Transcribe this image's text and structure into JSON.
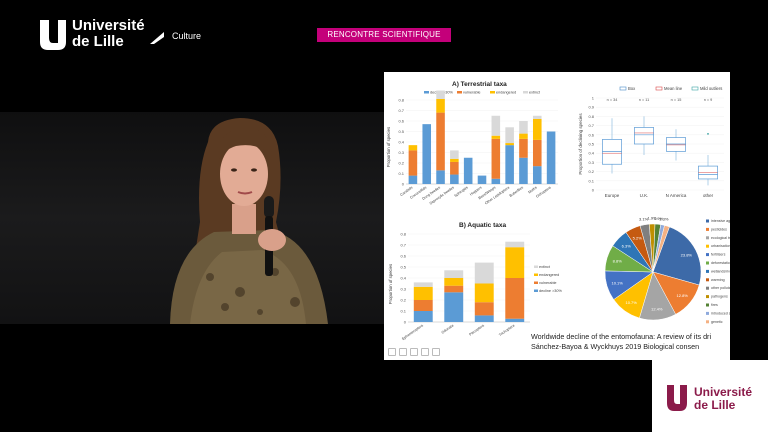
{
  "header": {
    "logo_line1": "Université",
    "logo_line2": "de Lille",
    "culture_label": "Culture",
    "badge": "RENCONTRE SCIENTIFIQUE"
  },
  "slide": {
    "caption_line1": "Worldwide decline of the entomofauna: A review of its dri",
    "caption_line2": "Sánchez-Bayoa & Wyckhuys 2019 Biological consen",
    "terrestrial": {
      "title": "A) Terrestrial taxa",
      "ylabel": "Proportion of species",
      "legend": [
        "decline >30%",
        "vulnerable",
        "endangered",
        "extinct"
      ],
      "yticks": [
        "0.8",
        "0.7",
        "0.6",
        "0.5",
        "0.4",
        "0.3",
        "0.2",
        "0.1",
        "0"
      ],
      "categories": [
        "Carabids",
        "Coccinellids",
        "Dung beetles",
        "Saproxylic beetles",
        "Sphingids",
        "Hoppers",
        "Bees/Wasps",
        "Other Lepidoptera",
        "Butterflies",
        "Moths",
        "Orthoptera"
      ]
    },
    "aquatic": {
      "title": "B) Aquatic taxa",
      "ylabel": "Proportion of species",
      "legend": [
        "extinct",
        "endangered",
        "vulnerable",
        "decline >30%"
      ],
      "yticks": [
        "0.8",
        "0.7",
        "0.6",
        "0.5",
        "0.4",
        "0.3",
        "0.2",
        "0.1",
        "0"
      ],
      "categories": [
        "Ephemeroptera",
        "Odonata",
        "Plecoptera",
        "Trichoptera"
      ]
    },
    "boxplot": {
      "legend": [
        "Box",
        "Mean line",
        "Mild outliers"
      ],
      "ylabel": "Proportion of declining species",
      "yticks": [
        "1",
        "0.9",
        "0.8",
        "0.7",
        "0.6",
        "0.5",
        "0.4",
        "0.3",
        "0.2",
        "0.1",
        "0"
      ],
      "n_labels": [
        "n = 34",
        "n = 11",
        "n = 15",
        "n = 9"
      ],
      "categories": [
        "Europe",
        "U.K.",
        "N America",
        "other"
      ]
    },
    "pie": {
      "slice_labels": [
        "23.8%",
        "12.8%",
        "12.4%",
        "10.7%",
        "10.1%",
        "8.8%",
        "6.3%",
        "5.2%",
        "3.1%",
        "1.9%",
        "1.9%",
        "1.3%"
      ],
      "legend": [
        "intensive agriculture",
        "pesticides",
        "ecological traits",
        "urbanisation",
        "fertilisers",
        "deforestation",
        "wetlands/rivers alteration",
        "warming",
        "other pollutants",
        "pathogens",
        "fires",
        "introduced species",
        "genetic"
      ]
    }
  },
  "footer": {
    "logo_line1": "Université",
    "logo_line2": "de Lille"
  },
  "colors": {
    "brand_pink": "#c4007a",
    "blue": "#5b9bd5",
    "orange": "#ed7d31",
    "gold": "#ffc000",
    "grey": "#d9d9d9",
    "pie_navy": "#3d6aa8"
  },
  "chart_data": [
    {
      "type": "bar",
      "title": "A) Terrestrial taxa",
      "ylabel": "Proportion of species",
      "ylim": [
        0,
        0.8
      ],
      "categories": [
        "Carabids",
        "Coccinellids",
        "Dung beetles",
        "Saproxylic beetles",
        "Sphingids",
        "Hoppers",
        "Bees/Wasps",
        "Other Lepidoptera",
        "Butterflies",
        "Moths",
        "Orthoptera"
      ],
      "series": [
        {
          "name": "decline >30%",
          "values": [
            0.08,
            0.57,
            0.13,
            0.09,
            0.25,
            0.08,
            0.05,
            0.37,
            0.25,
            0.17,
            0.5
          ]
        },
        {
          "name": "vulnerable",
          "values": [
            0.24,
            0.0,
            0.55,
            0.12,
            0.0,
            0.0,
            0.38,
            0.0,
            0.18,
            0.25,
            0.0
          ]
        },
        {
          "name": "endangered",
          "values": [
            0.05,
            0.0,
            0.13,
            0.03,
            0.0,
            0.0,
            0.03,
            0.02,
            0.05,
            0.2,
            0.0
          ]
        },
        {
          "name": "extinct",
          "values": [
            0.0,
            0.0,
            0.08,
            0.08,
            0.0,
            0.0,
            0.19,
            0.15,
            0.12,
            0.03,
            0.0
          ]
        }
      ]
    },
    {
      "type": "bar",
      "title": "B) Aquatic taxa",
      "ylabel": "Proportion of species",
      "ylim": [
        0,
        0.8
      ],
      "categories": [
        "Ephemeroptera",
        "Odonata",
        "Plecoptera",
        "Trichoptera"
      ],
      "series": [
        {
          "name": "decline >30%",
          "values": [
            0.1,
            0.27,
            0.06,
            0.03
          ]
        },
        {
          "name": "vulnerable",
          "values": [
            0.1,
            0.06,
            0.12,
            0.37
          ]
        },
        {
          "name": "endangered",
          "values": [
            0.12,
            0.07,
            0.17,
            0.28
          ]
        },
        {
          "name": "extinct",
          "values": [
            0.04,
            0.07,
            0.19,
            0.05
          ]
        }
      ]
    },
    {
      "type": "boxplot",
      "ylabel": "Proportion of declining species",
      "ylim": [
        0,
        1
      ],
      "categories": [
        "Europe",
        "U.K.",
        "N America",
        "other"
      ],
      "n": [
        34,
        11,
        15,
        9
      ],
      "boxes": [
        {
          "min": 0.18,
          "q1": 0.28,
          "median": 0.42,
          "q3": 0.55,
          "max": 0.78,
          "mean": 0.4
        },
        {
          "min": 0.38,
          "q1": 0.5,
          "median": 0.6,
          "q3": 0.68,
          "max": 0.8,
          "mean": 0.62
        },
        {
          "min": 0.32,
          "q1": 0.42,
          "median": 0.5,
          "q3": 0.57,
          "max": 0.66,
          "mean": 0.49
        },
        {
          "min": 0.05,
          "q1": 0.12,
          "median": 0.17,
          "q3": 0.26,
          "max": 0.38,
          "mean": 0.19,
          "outliers": [
            0.61
          ]
        }
      ]
    },
    {
      "type": "pie",
      "labels": [
        "intensive agriculture",
        "pesticides",
        "ecological traits",
        "urbanisation",
        "fertilisers",
        "deforestation",
        "wetlands/rivers alteration",
        "warming",
        "other pollutants",
        "pathogens",
        "fires",
        "introduced species",
        "genetic"
      ],
      "values": [
        23.8,
        12.8,
        12.4,
        10.7,
        10.1,
        8.8,
        6.3,
        5.2,
        3.1,
        1.9,
        1.9,
        1.3,
        1.7
      ]
    }
  ]
}
